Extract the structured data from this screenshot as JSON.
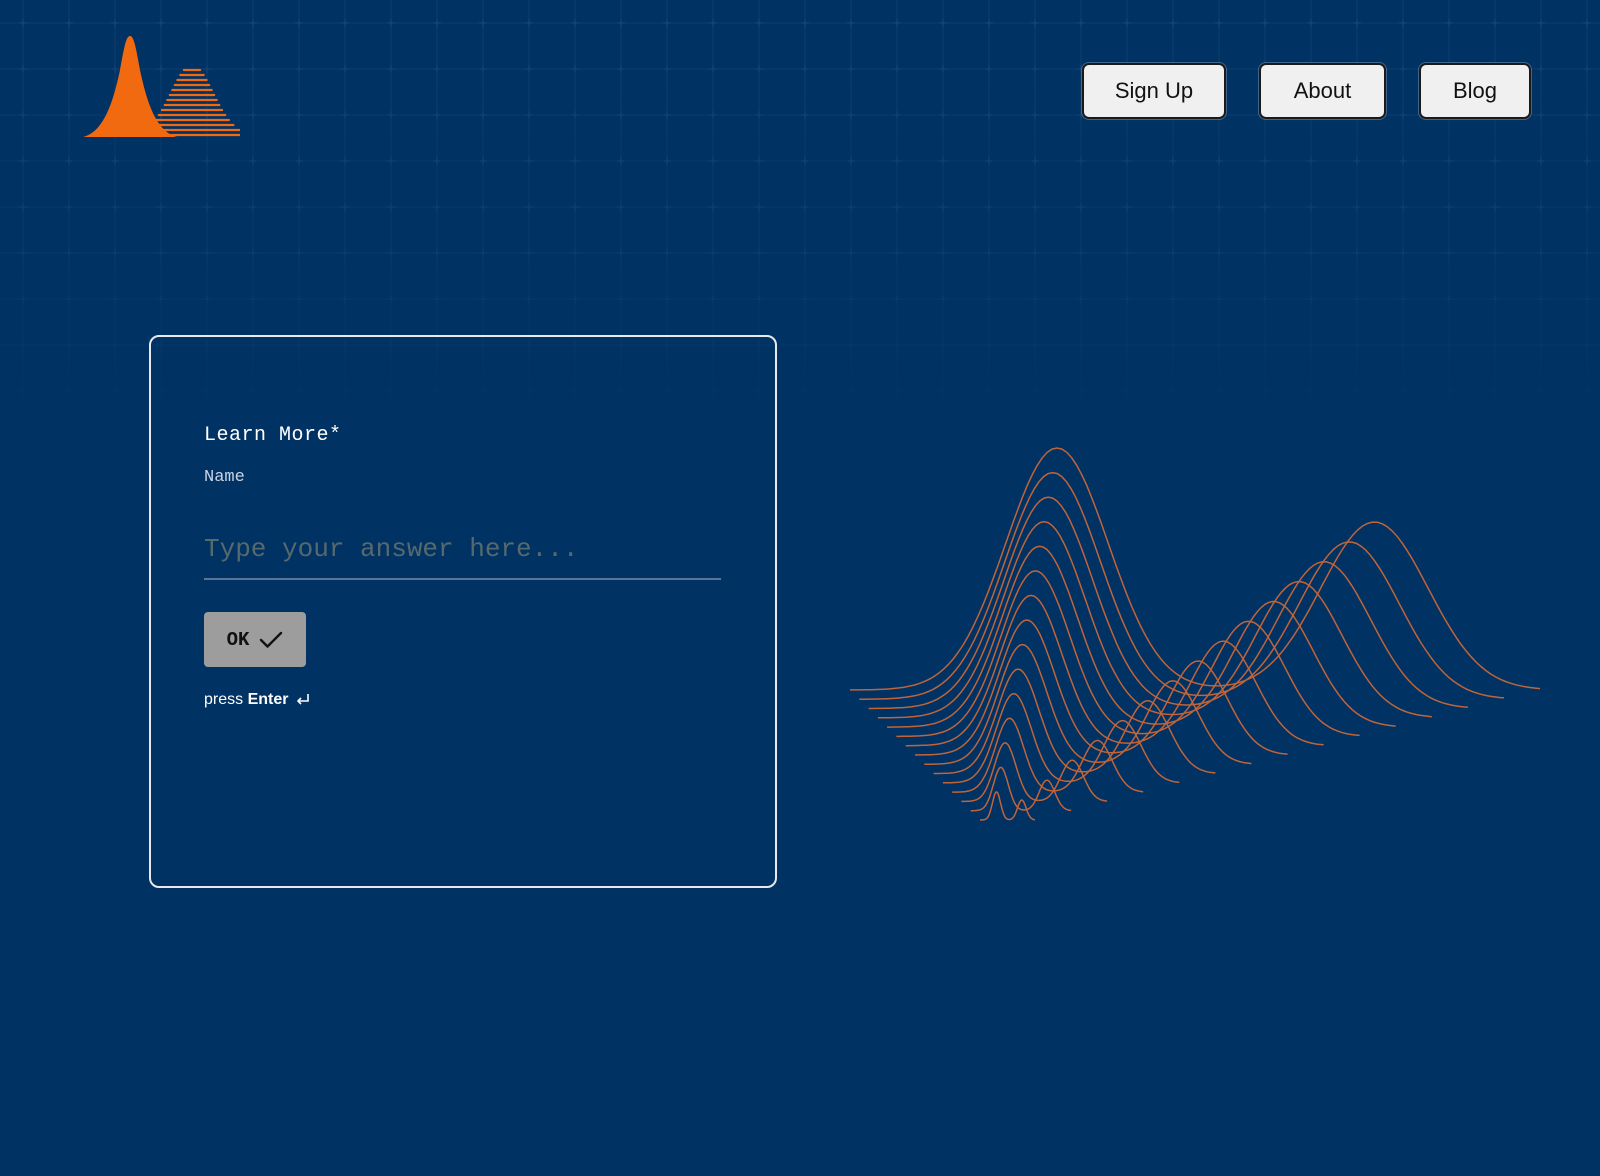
{
  "header": {
    "logo_icon": "bell-curve-logo",
    "nav": [
      {
        "label": "Sign Up"
      },
      {
        "label": "About"
      },
      {
        "label": "Blog"
      }
    ]
  },
  "form": {
    "question_title": "Learn More*",
    "question_subtitle": "Name",
    "answer_placeholder": "Type your answer here...",
    "ok_label": "OK",
    "ok_icon": "checkmark-icon",
    "hint_prefix": "press ",
    "hint_key": "Enter",
    "hint_icon": "enter-key-icon"
  },
  "decoration": {
    "icon": "wave-lines-graphic"
  },
  "colors": {
    "background": "#003263",
    "accent": "#F26A0F",
    "wave_stroke": "#C0643A",
    "nav_button_bg": "#F0F0F0",
    "ok_button_bg": "#9D9D9D"
  }
}
